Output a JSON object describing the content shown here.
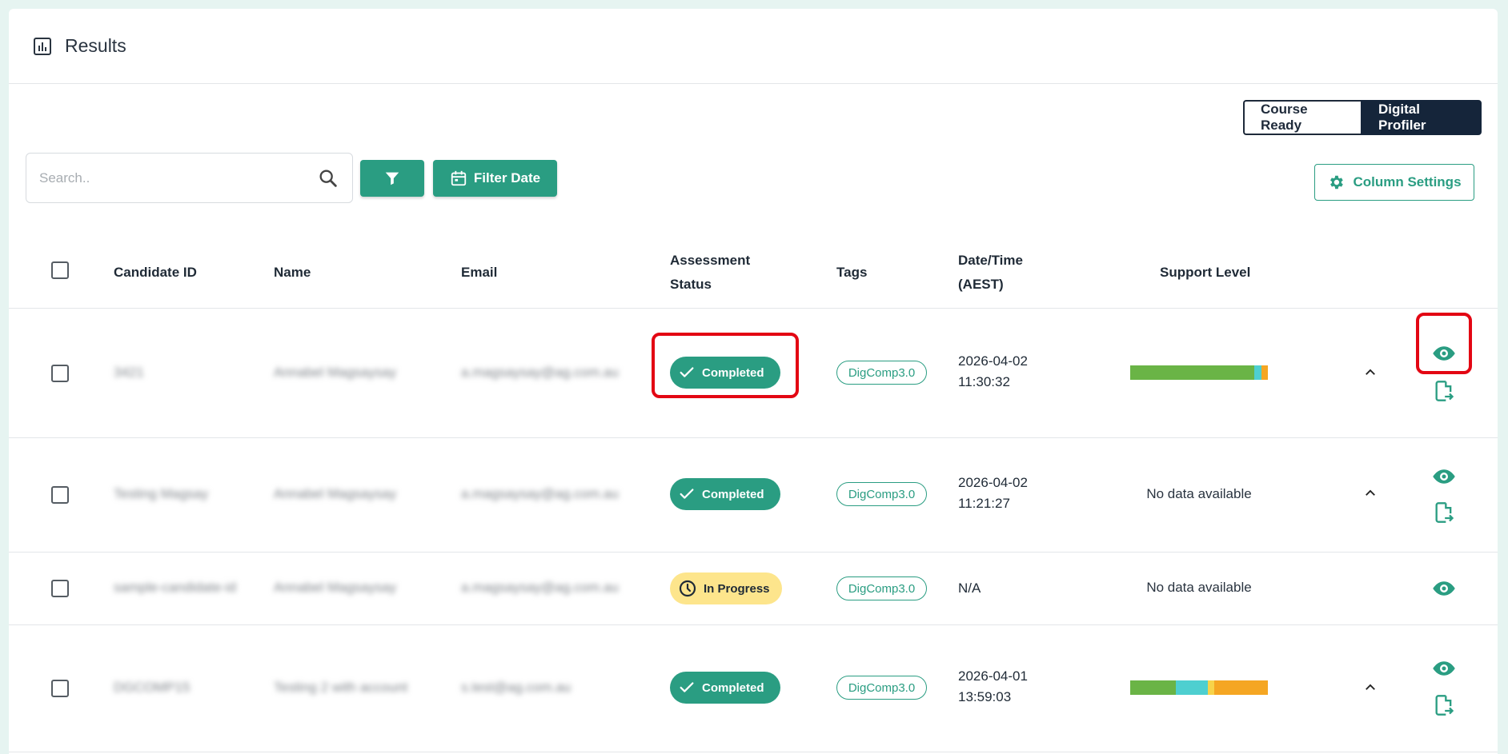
{
  "header": {
    "title": "Results",
    "icon": "bar-chart-icon"
  },
  "toggle": {
    "course_ready": "Course Ready",
    "digital_profiler": "Digital Profiler",
    "active": "Digital Profiler"
  },
  "toolbar": {
    "search_placeholder": "Search..",
    "filter_date_label": "Filter Date",
    "column_settings_label": "Column Settings"
  },
  "table": {
    "headers": {
      "candidate_id": "Candidate ID",
      "name": "Name",
      "email": "Email",
      "status_line1": "Assessment",
      "status_line2": "Status",
      "tags": "Tags",
      "datetime_line1": "Date/Time",
      "datetime_line2": "(AEST)",
      "support_level": "Support Level"
    },
    "rows": [
      {
        "candidate_id": "3421",
        "name": "Annabel Magsaysay",
        "email": "a.magsaysay@ag.com.au",
        "status": "Completed",
        "tag": "DigComp3.0",
        "date": "2026-04-02",
        "time": "11:30:32",
        "support_level": [
          0.9,
          0.05,
          0.05
        ],
        "no_data": ""
      },
      {
        "candidate_id": "Testing Magsay",
        "name": "Annabel Magsaysay",
        "email": "a.magsaysay@ag.com.au",
        "status": "Completed",
        "tag": "DigComp3.0",
        "date": "2026-04-02",
        "time": "11:21:27",
        "support_level": null,
        "no_data": "No data available"
      },
      {
        "candidate_id": "sample-candidate-id",
        "name": "Annabel Magsaysay",
        "email": "a.magsaysay@ag.com.au",
        "status": "In Progress",
        "tag": "DigComp3.0",
        "date": "N/A",
        "time": "",
        "support_level": null,
        "no_data": "No data available"
      },
      {
        "candidate_id": "DGCOMP15",
        "name": "Testing 2 with account",
        "email": "s.test@ag.com.au",
        "status": "Completed",
        "tag": "DigComp3.0",
        "date": "2026-04-01",
        "time": "13:59:03",
        "support_level": [
          0.33,
          0.23,
          0.05,
          0.39
        ],
        "no_data": ""
      }
    ]
  },
  "colors": {
    "accent": "#2a9d82",
    "navy": "#15253a",
    "bar_green": "#6ab446",
    "bar_cyan": "#4ecfd0",
    "bar_yellow": "#f7d34a",
    "bar_orange": "#f5a623",
    "in_progress_bg": "#fde58c",
    "highlight": "#e30613"
  }
}
